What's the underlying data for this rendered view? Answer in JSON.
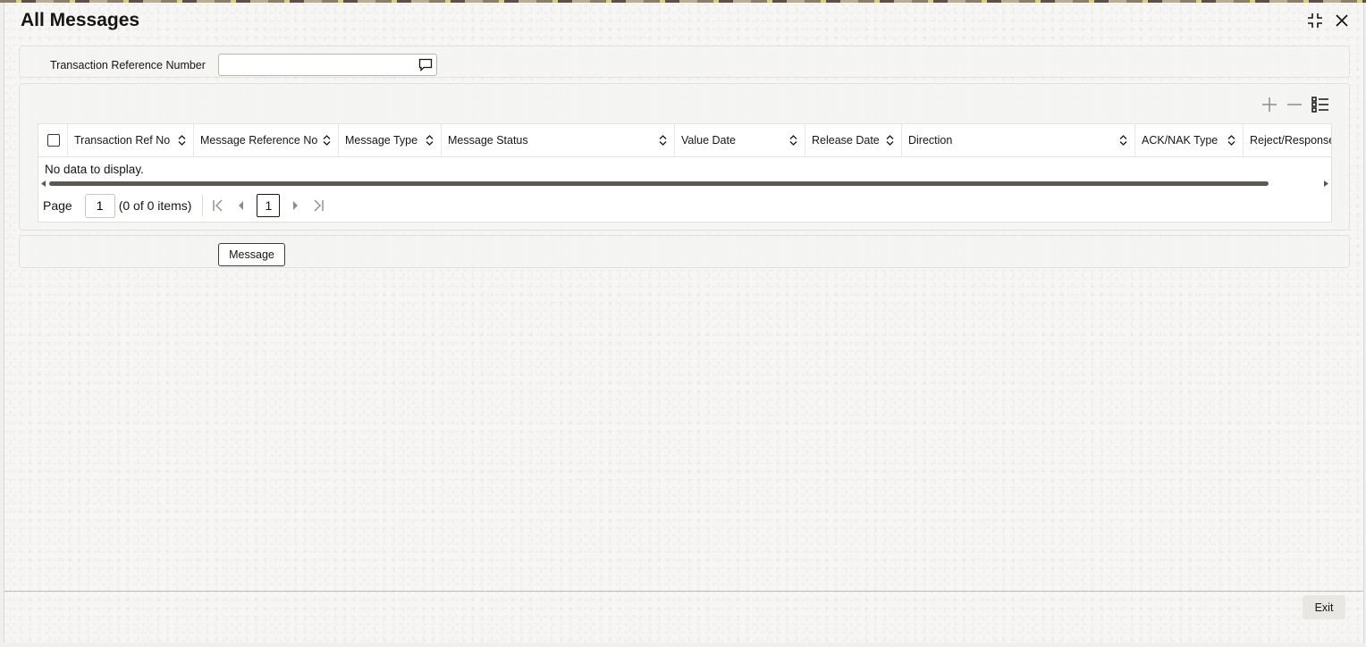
{
  "window": {
    "title": "All Messages",
    "icons": [
      "collapse-icon",
      "close-icon"
    ]
  },
  "filter": {
    "label": "Transaction Reference Number",
    "value": "",
    "lov_icon": "lov-search-icon"
  },
  "grid": {
    "tools": [
      "add-row-icon",
      "remove-row-icon",
      "column-settings-icon"
    ],
    "columns": [
      "Transaction Ref No",
      "Message Reference No",
      "Message Type",
      "Message Status",
      "Value Date",
      "Release Date",
      "Direction",
      "ACK/NAK Type",
      "Reject/Response"
    ],
    "empty_text": "No data to display.",
    "pager": {
      "label": "Page",
      "page_input": "1",
      "info": "(0 of 0 items)",
      "current_page": "1"
    }
  },
  "actions": {
    "message_button": "Message"
  },
  "footer": {
    "exit_button": "Exit"
  }
}
